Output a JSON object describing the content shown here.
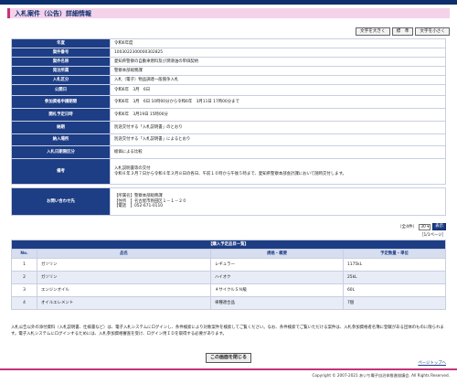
{
  "page": {
    "title": "入札案件（公告）詳細情報",
    "font_buttons": [
      "文字を大きく",
      "標　準",
      "文字を小さく"
    ]
  },
  "detail": [
    {
      "label": "年度",
      "value": "令和6年度"
    },
    {
      "label": "案件番号",
      "value": "1003022300000302825"
    },
    {
      "label": "案件名称",
      "value": "愛知県警察の自動車燃料及び潤滑油の単価契約"
    },
    {
      "label": "発注所属",
      "value": "警察本部総務課"
    },
    {
      "label": "入札区分",
      "value": "入札（電子）物品調達一般競争入札"
    },
    {
      "label": "公開日",
      "value": "令和6年　3月　6日"
    },
    {
      "label": "参加資格申請期間",
      "value": "令和6年　3月　6日 10時00分から令和6年　3月11日 17時00分まで"
    },
    {
      "label": "開札予定日時",
      "value": "令和6年　3月19日 15時00分"
    },
    {
      "label": "納期",
      "value": "別途交付する「入札説明書」のとおり"
    },
    {
      "label": "納入場所",
      "value": "別途交付する「入札説明書」によるとおり"
    },
    {
      "label": "入札日期限区分",
      "value": "総価による比較"
    },
    {
      "label": "備考",
      "value": [
        "入札説明書等の交付",
        "令和６年３月７日から令和６年３月８日の各日、午前１０時から午後５時まで、愛知県警察本部会計課において随時交付します。"
      ]
    }
  ],
  "contact": {
    "label": "お問い合わせ先",
    "lines": [
      "【所属名】警察本部総務課",
      "【住所　】名古屋市熱田区１－１－２０",
      "【電話　】052-671-0110"
    ]
  },
  "pager": {
    "count": "（全4件）",
    "per_page": "30",
    "button": "表示",
    "page_info": "［1/1ページ］"
  },
  "items": {
    "caption": "【購入予定品目一覧】",
    "headers": [
      "No.",
      "品名",
      "規格・概要",
      "予定数量・単位"
    ],
    "rows": [
      [
        "1",
        "ガソリン",
        "レギュラー",
        "1175kL"
      ],
      [
        "2",
        "ガソリン",
        "ハイオク",
        "25kL"
      ],
      [
        "3",
        "エンジンオイル",
        "４サイクルＳＮ級",
        "60L"
      ],
      [
        "4",
        "オイルエレメント",
        "車種適合品",
        "7個"
      ]
    ]
  },
  "notes": {
    "text": "入札公告以外の添付資料（入札説明書、仕様書など）は、電子入札システムにログインし、条件検索により対象案件を検索してご覧ください。なお、条件検索でご覧いただける案件は、入札参加資格者名簿に登載がある団体のものに限られます。電子入札システムにログインするためには、入札参加資格審査を受け、ログイン用ＩＤを取得する必要があります。"
  },
  "footer": {
    "close": "この画面を閉じる",
    "to_top": "ページトップへ",
    "copyright": "Copyright © 2007-2021 あいち電子自治体推進協議会. All Rights Reserved."
  },
  "colors": {
    "navy": "#1d3d85",
    "header_dark": "#0d2f6e",
    "accent_pink": "#c2347a",
    "title_bg": "#f4d2ea"
  }
}
